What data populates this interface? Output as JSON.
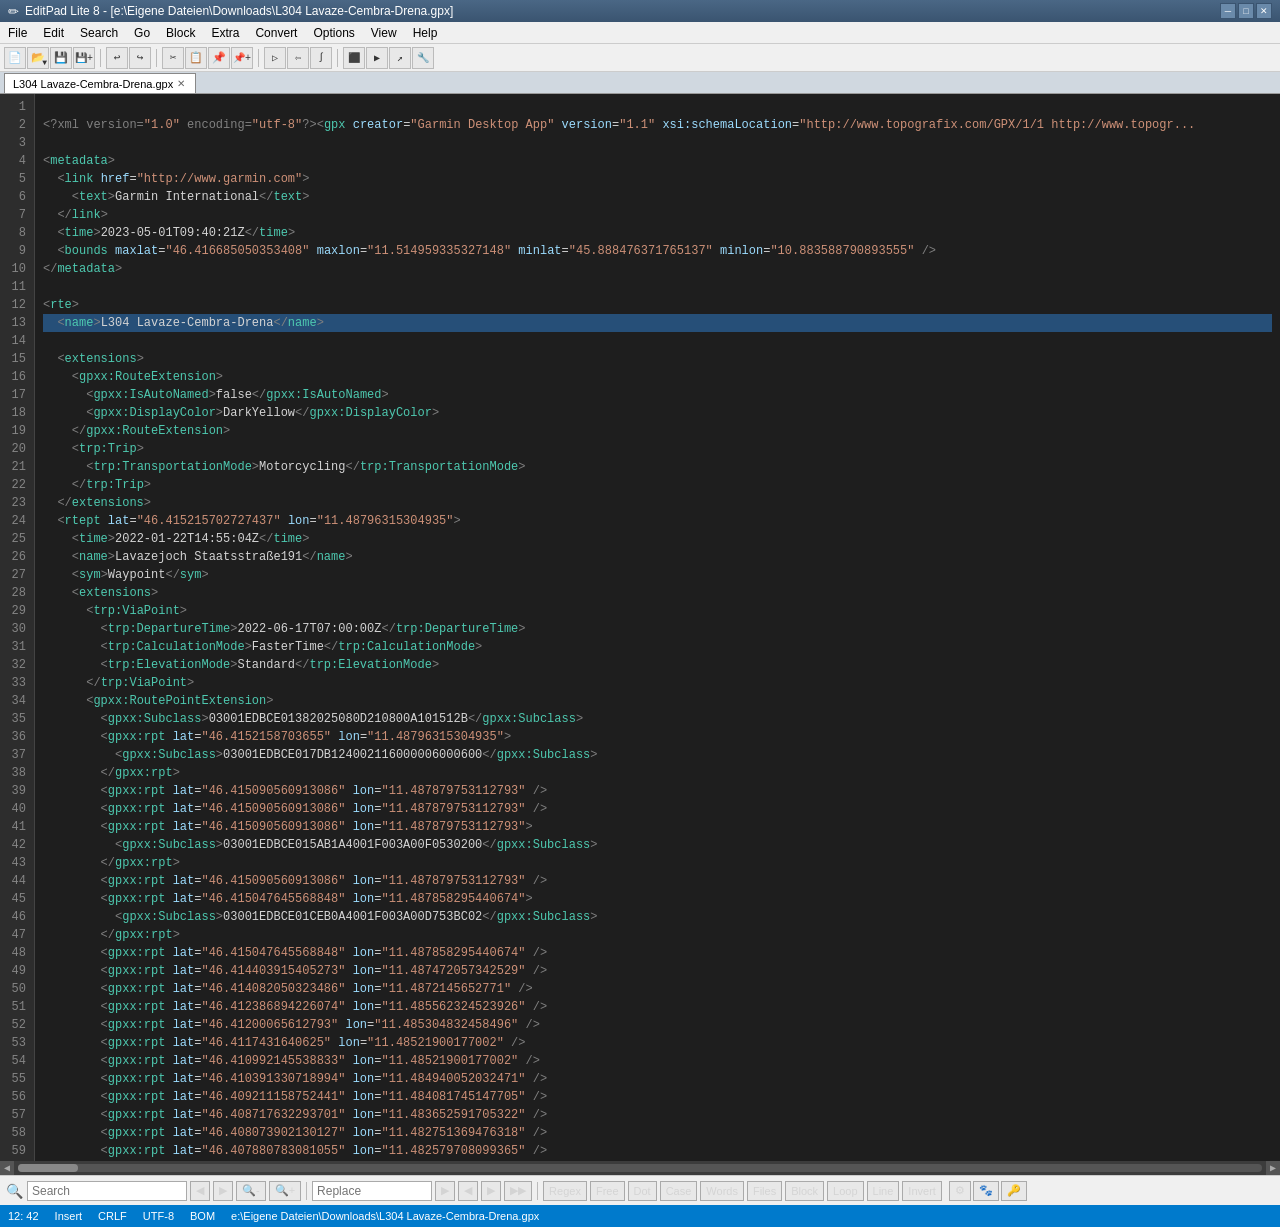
{
  "titlebar": {
    "icon": "✏",
    "title": "EditPad Lite 8 - [e:\\Eigene Dateien\\Downloads\\L304 Lavaze-Cembra-Drena.gpx]",
    "minimize": "─",
    "maximize": "□",
    "close": "✕"
  },
  "menubar": {
    "items": [
      "File",
      "Edit",
      "Search",
      "Go",
      "Block",
      "Extra",
      "Convert",
      "Options",
      "View",
      "Help"
    ]
  },
  "tabs": [
    {
      "label": "L304 Lavaze-Cembra-Drena.gpx",
      "active": true
    }
  ],
  "statusbar": {
    "position": "12: 42",
    "mode": "Insert",
    "lineending": "CRLF",
    "encoding": "UTF-8",
    "bom": "BOM",
    "filepath": "e:\\Eigene Dateien\\Downloads\\L304 Lavaze-Cembra-Drena.gpx"
  },
  "searchbar": {
    "search_placeholder": "Search",
    "replace_placeholder": "Replace",
    "search_label": "Search",
    "buttons": {
      "regex": "Regex",
      "free": "Free",
      "dot": "Dot",
      "case": "Case",
      "words": "Words",
      "files": "Files",
      "block": "Block",
      "loop": "Loop",
      "line": "Line",
      "invert": "Invert"
    }
  }
}
